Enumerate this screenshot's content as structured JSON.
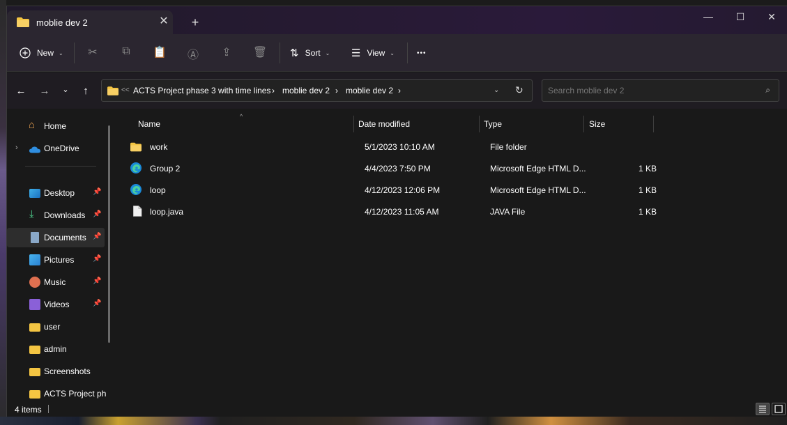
{
  "window": {
    "tab_title": "moblie dev 2",
    "tab_close": "✕",
    "new_tab": "+",
    "minimize": "—",
    "maximize": "☐",
    "close": "✕"
  },
  "toolbar": {
    "new_label": "New",
    "sort_label": "Sort",
    "view_label": "View",
    "more": "•••"
  },
  "address": {
    "overflow": "<<",
    "crumbs": [
      "ACTS Project phase 3 with time lines",
      "moblie dev 2",
      "moblie dev 2"
    ],
    "separator": "›"
  },
  "search": {
    "placeholder": "Search moblie dev 2"
  },
  "sidebar": {
    "items": [
      {
        "label": "Home",
        "icon": "home-icon"
      },
      {
        "label": "OneDrive",
        "icon": "cloud-icon"
      },
      {
        "label": "Desktop",
        "icon": "desktop-icon",
        "pinned": true
      },
      {
        "label": "Downloads",
        "icon": "download-icon",
        "pinned": true
      },
      {
        "label": "Documents",
        "icon": "document-icon",
        "pinned": true
      },
      {
        "label": "Pictures",
        "icon": "picture-icon",
        "pinned": true
      },
      {
        "label": "Music",
        "icon": "music-icon",
        "pinned": true
      },
      {
        "label": "Videos",
        "icon": "video-icon",
        "pinned": true
      },
      {
        "label": "user",
        "icon": "folder-icon"
      },
      {
        "label": "admin",
        "icon": "folder-icon"
      },
      {
        "label": "Screenshots",
        "icon": "folder-icon"
      },
      {
        "label": "ACTS Project ph",
        "icon": "folder-icon"
      }
    ]
  },
  "columns": {
    "name": "Name",
    "date": "Date modified",
    "type": "Type",
    "size": "Size"
  },
  "files": [
    {
      "name": "work",
      "date": "5/1/2023 10:10 AM",
      "type": "File folder",
      "size": "",
      "icon": "folder-icon"
    },
    {
      "name": "Group 2",
      "date": "4/4/2023 7:50 PM",
      "type": "Microsoft Edge HTML D...",
      "size": "1 KB",
      "icon": "edge-icon"
    },
    {
      "name": "loop",
      "date": "4/12/2023 12:06 PM",
      "type": "Microsoft Edge HTML D...",
      "size": "1 KB",
      "icon": "edge-icon"
    },
    {
      "name": "loop.java",
      "date": "4/12/2023 11:05 AM",
      "type": "JAVA File",
      "size": "1 KB",
      "icon": "file-icon"
    }
  ],
  "status": {
    "count": "4 items"
  },
  "colors": {
    "folder": "#f4c542",
    "accent": "#4ca8e8"
  }
}
